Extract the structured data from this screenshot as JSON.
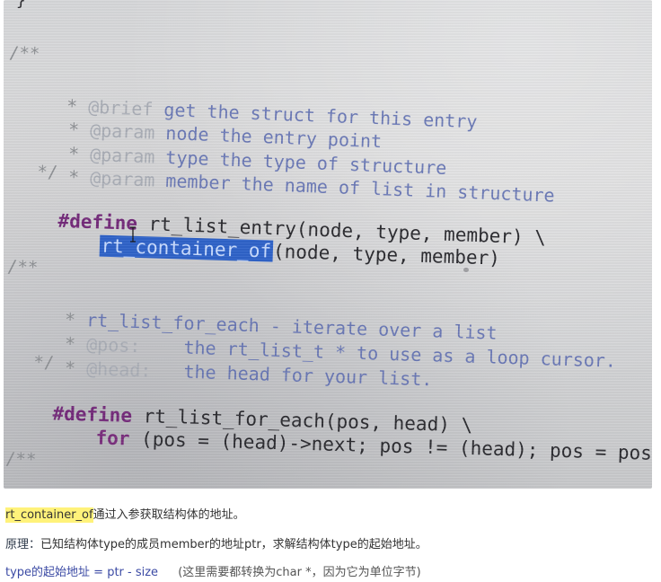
{
  "code_photo": {
    "top_brace": "}",
    "lines": [
      "/**",
      " * @brief get the struct for this entry",
      " * @param node the entry point",
      " * @param type the type of structure",
      " * @param member the name of list in structure",
      " */",
      "#define rt_list_entry(node, type, member) \\",
      "    rt_container_of(node, type, member)",
      "/**",
      " * rt_list_for_each - iterate over a list",
      " * @pos:    the rt_list_t * to use as a loop cursor.",
      " * @head:   the head for your list.",
      " */",
      "#define rt_list_for_each(pos, head) \\",
      "    for (pos = (head)->next; pos != (head); pos = pos->next)",
      "/**"
    ],
    "selected_text": "rt_container_of"
  },
  "caption": {
    "highlight_term": "rt_container_of",
    "desc": "通过入参获取结构体的地址。"
  },
  "principle": {
    "label": "原理：",
    "text": "已知结构体type的成员member的地址ptr，求解结构体type的起始地址。"
  },
  "formula": {
    "expr": "type的起始地址 = ptr - size",
    "note": "(这里需要都转换为char *，因为它为单位字节)"
  },
  "colors": {
    "highlight": "#fff27a",
    "selection": "#2f63c9",
    "keyword": "#742a7a",
    "comment": "#5f6fb3"
  }
}
